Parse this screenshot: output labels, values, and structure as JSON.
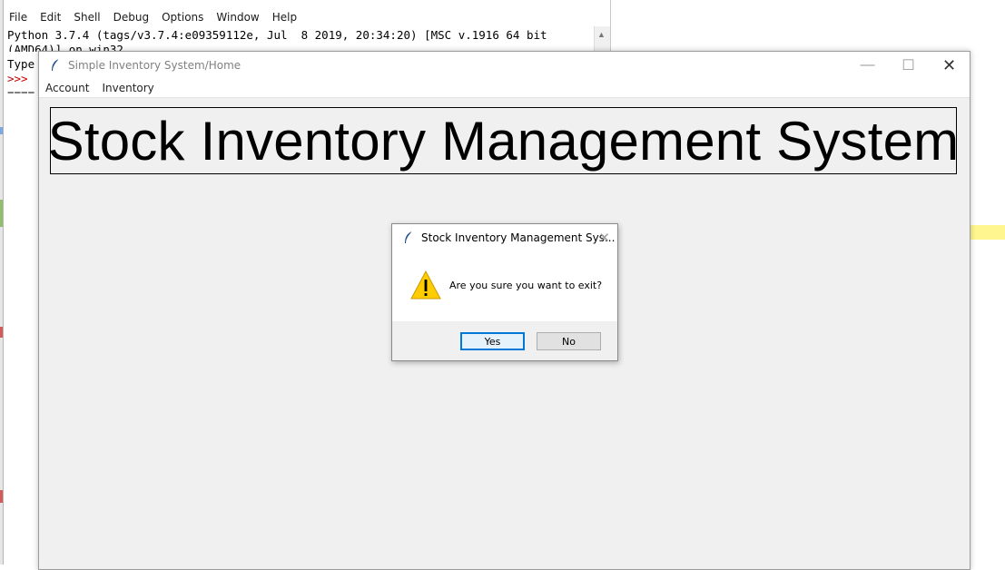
{
  "idle_shell": {
    "title_remnant": "",
    "menu": [
      "File",
      "Edit",
      "Shell",
      "Debug",
      "Options",
      "Window",
      "Help"
    ],
    "lines": [
      "Python 3.7.4 (tags/v3.7.4:e09359112e, Jul  8 2019, 20:34:20) [MSC v.1916 64 bit",
      "(AMD64)] on win32",
      "Type",
      ">>>",
      "===="
    ]
  },
  "main_window": {
    "title": "Simple Inventory System/Home",
    "menu": [
      "Account",
      "Inventory"
    ],
    "heading": "Stock Inventory Management System",
    "controls": {
      "minimize": "—",
      "maximize": "☐",
      "close": "✕"
    }
  },
  "dialog": {
    "title": "Stock Inventory Management Sys...",
    "message": "Are you sure you want to exit?",
    "yes_label": "Yes",
    "no_label": "No",
    "icon": "warning-icon",
    "close": "✕"
  },
  "colors": {
    "accent": "#0078d7",
    "warning": "#ffcc00",
    "highlight": "#fff68f"
  }
}
